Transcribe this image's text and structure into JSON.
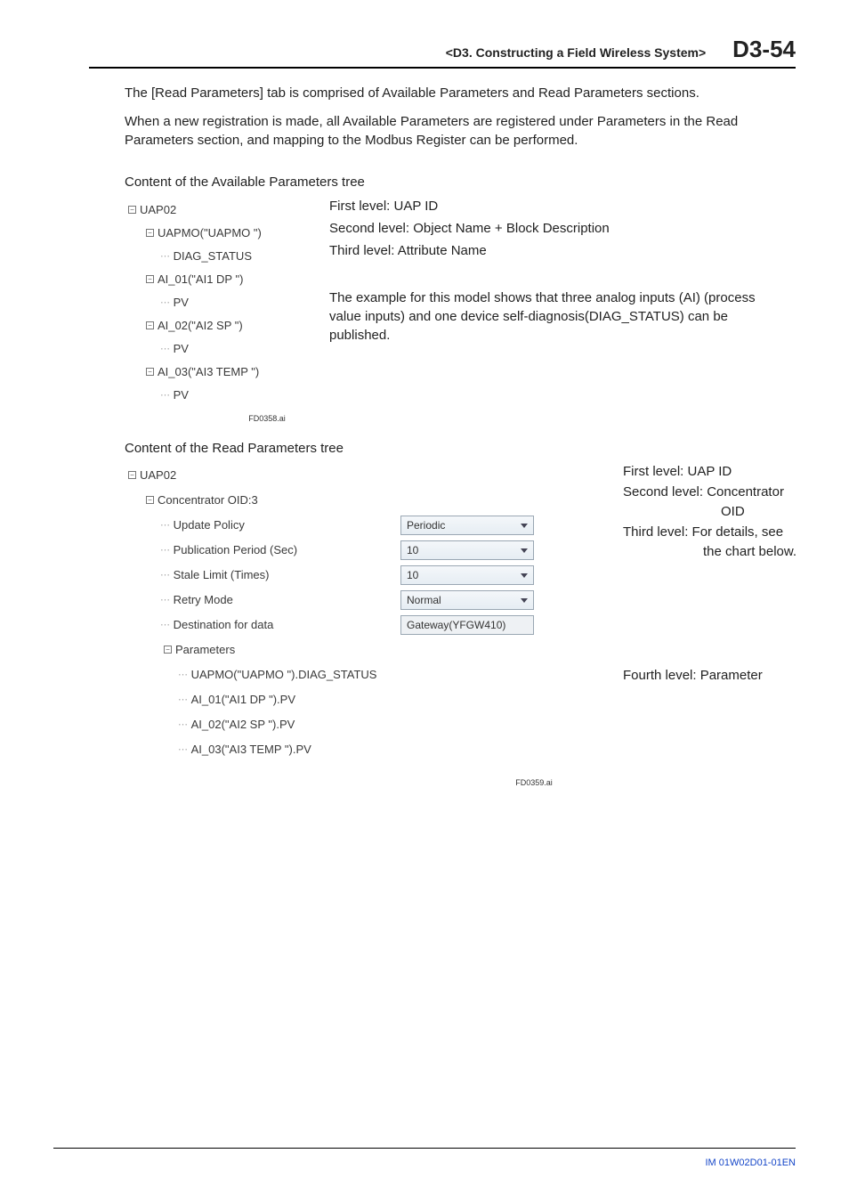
{
  "header": {
    "title": "<D3.  Constructing a Field Wireless System>",
    "page": "D3-54"
  },
  "intro": {
    "p1": "The [Read Parameters] tab is comprised of Available Parameters and Read Parameters sections.",
    "p2": "When a new registration is made, all Available Parameters are registered under Parameters in the Read Parameters section, and mapping to the Modbus Register can be performed."
  },
  "avail": {
    "title": "Content of the Available Parameters tree",
    "tree": {
      "n0": "UAP02",
      "n1": "UAPMO(\"UAPMO \")",
      "n1a": "DIAG_STATUS",
      "n2": "AI_01(\"AI1 DP    \")",
      "n2a": "PV",
      "n3": "AI_02(\"AI2 SP    \")",
      "n3a": "PV",
      "n4": "AI_03(\"AI3 TEMP \")",
      "n4a": "PV"
    },
    "desc": {
      "l1": "First level: UAP ID",
      "l2": "Second level: Object Name + Block Description",
      "l3": "Third level: Attribute Name",
      "ex": "The example for this model shows that three analog inputs (AI) (process value inputs) and one device self-diagnosis(DIAG_STATUS) can be published."
    },
    "figlabel": "FD0358.ai"
  },
  "read": {
    "title": "Content of the Read Parameters tree",
    "tree": {
      "n0": "UAP02",
      "n1": "Concentrator OID:3",
      "r_update": {
        "label": "Update Policy",
        "value": "Periodic"
      },
      "r_pub": {
        "label": "Publication Period (Sec)",
        "value": "10"
      },
      "r_stale": {
        "label": "Stale Limit (Times)",
        "value": "10"
      },
      "r_retry": {
        "label": "Retry Mode",
        "value": "Normal"
      },
      "r_dest": {
        "label": "Destination for data",
        "value": "Gateway(YFGW410)"
      },
      "n2": "Parameters",
      "p1": "UAPMO(\"UAPMO \").DIAG_STATUS",
      "p2": "AI_01(\"AI1 DP    \").PV",
      "p3": "AI_02(\"AI2 SP    \").PV",
      "p4": "AI_03(\"AI3 TEMP \").PV"
    },
    "side": {
      "l1": "First level: UAP ID",
      "l2a": "Second level: Concentrator",
      "l2b": "OID",
      "l3a": "Third level: For details, see",
      "l3b": "the chart below.",
      "l4": "Fourth level: Parameter"
    },
    "figlabel": "FD0359.ai"
  },
  "footer": {
    "doc": "IM 01W02D01-01EN"
  }
}
